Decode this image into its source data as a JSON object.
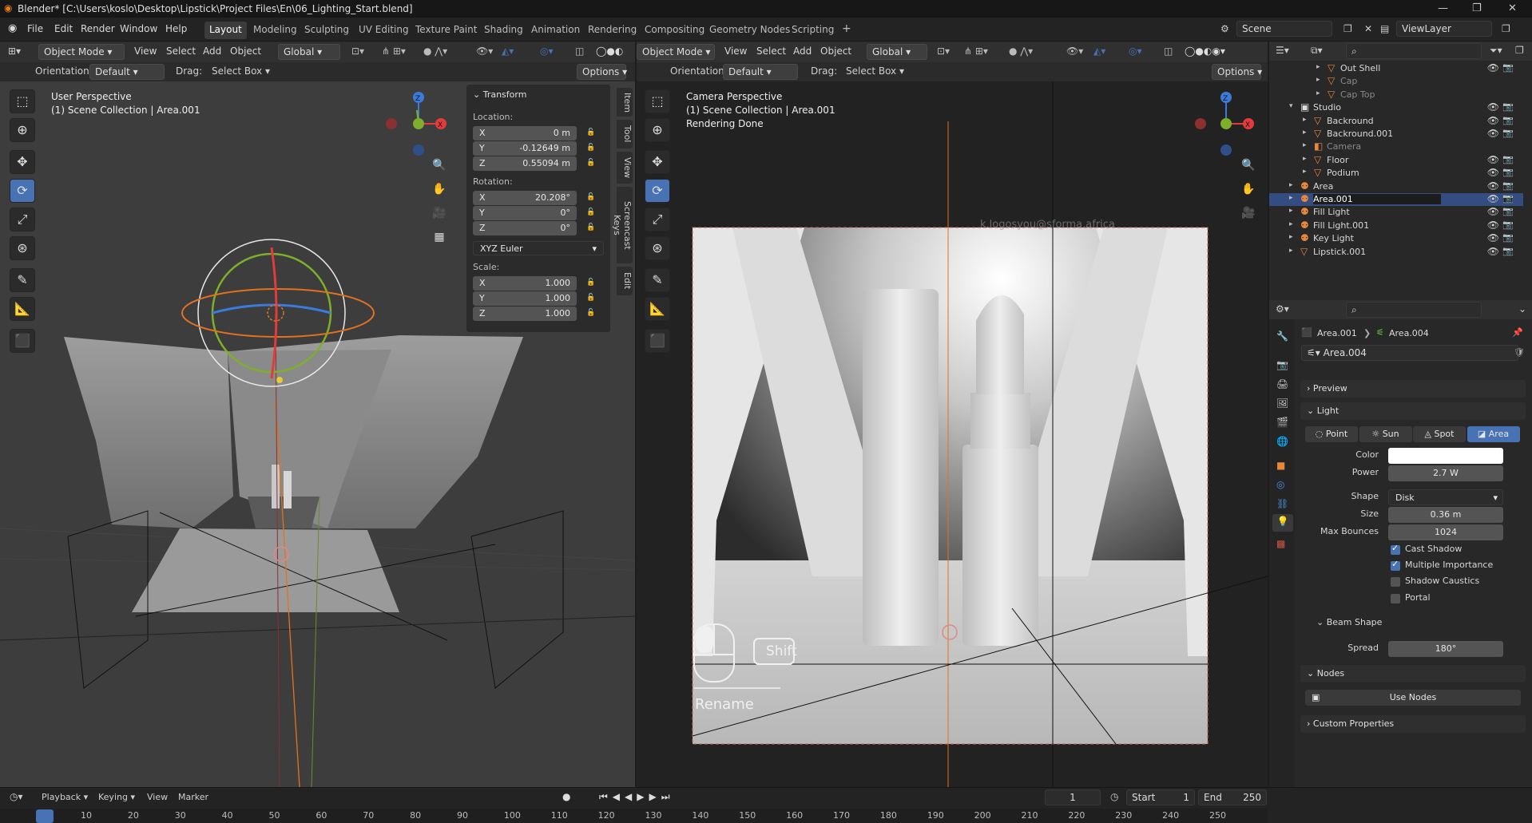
{
  "titlebar": {
    "title": "Blender* [C:\\Users\\koslo\\Desktop\\Lipstick\\Project Files\\En\\06_Lighting_Start.blend]"
  },
  "menu": [
    "File",
    "Edit",
    "Render",
    "Window",
    "Help"
  ],
  "workspaces": [
    "Layout",
    "Modeling",
    "Sculpting",
    "UV Editing",
    "Texture Paint",
    "Shading",
    "Animation",
    "Rendering",
    "Compositing",
    "Geometry Nodes",
    "Scripting"
  ],
  "scene": {
    "scene_name": "Scene",
    "view_layer": "ViewLayer"
  },
  "left_view": {
    "mode": "Object Mode",
    "menus": [
      "View",
      "Select",
      "Add",
      "Object"
    ],
    "transform_orient": "Global",
    "orientation_label": "Orientation:",
    "orientation_value": "Default",
    "drag_label": "Drag:",
    "drag_value": "Select Box",
    "options": "Options",
    "title": "User Perspective",
    "subtitle": "(1) Scene Collection | Area.001",
    "tabs": [
      "Item",
      "Tool",
      "View",
      "Screencast Keys",
      "Edit"
    ],
    "transform": {
      "header": "Transform",
      "location_label": "Location:",
      "rotation_label": "Rotation:",
      "scale_label": "Scale:",
      "location": [
        {
          "axis": "X",
          "value": "0 m"
        },
        {
          "axis": "Y",
          "value": "-0.12649 m"
        },
        {
          "axis": "Z",
          "value": "0.55094 m"
        }
      ],
      "rotation": [
        {
          "axis": "X",
          "value": "20.208°"
        },
        {
          "axis": "Y",
          "value": "0°"
        },
        {
          "axis": "Z",
          "value": "0°"
        }
      ],
      "rotation_mode": "XYZ Euler",
      "scale": [
        {
          "axis": "X",
          "value": "1.000"
        },
        {
          "axis": "Y",
          "value": "1.000"
        },
        {
          "axis": "Z",
          "value": "1.000"
        }
      ]
    }
  },
  "right_view": {
    "mode": "Object Mode",
    "menus": [
      "View",
      "Select",
      "Add",
      "Object"
    ],
    "transform_orient": "Global",
    "orientation_label": "Orientation:",
    "orientation_value": "Default",
    "drag_label": "Drag:",
    "drag_value": "Select Box",
    "options": "Options",
    "title": "Camera Perspective",
    "subtitle": "(1) Scene Collection | Area.001",
    "status": "Rendering Done",
    "overlay_key": "Shift",
    "overlay_action": "Rename",
    "watermark": "k.logosyou@sforma.africa"
  },
  "gizmo": {
    "z": "Z",
    "x": "X",
    "y": "Y"
  },
  "outliner": {
    "rows": [
      {
        "label": "Out Shell",
        "indent": 3,
        "state": "normal"
      },
      {
        "label": "Cap",
        "indent": 3,
        "state": "dim"
      },
      {
        "label": "Cap Top",
        "indent": 3,
        "state": "dim"
      },
      {
        "label": "Studio",
        "indent": 1,
        "state": "collection"
      },
      {
        "label": "Backround",
        "indent": 2,
        "state": "normal"
      },
      {
        "label": "Backround.001",
        "indent": 2,
        "state": "normal"
      },
      {
        "label": "Camera",
        "indent": 2,
        "state": "dim"
      },
      {
        "label": "Floor",
        "indent": 2,
        "state": "normal"
      },
      {
        "label": "Podium",
        "indent": 2,
        "state": "normal"
      },
      {
        "label": "Area",
        "indent": 1,
        "state": "light"
      },
      {
        "label": "Area.001",
        "indent": 1,
        "state": "selected"
      },
      {
        "label": "Fill Light",
        "indent": 1,
        "state": "light"
      },
      {
        "label": "Fill Light.001",
        "indent": 1,
        "state": "light"
      },
      {
        "label": "Key Light",
        "indent": 1,
        "state": "light"
      },
      {
        "label": "Lipstick.001",
        "indent": 1,
        "state": "normal"
      }
    ]
  },
  "properties": {
    "breadcrumb_obj": "Area.001",
    "breadcrumb_data": "Area.004",
    "datablock": "Area.004",
    "preview": "Preview",
    "light": "Light",
    "light_types": [
      {
        "label": "Point",
        "active": false
      },
      {
        "label": "Sun",
        "active": false
      },
      {
        "label": "Spot",
        "active": false
      },
      {
        "label": "Area",
        "active": true
      }
    ],
    "color_label": "Color",
    "color": "#ffffff",
    "power_label": "Power",
    "power": "2.7 W",
    "shape_label": "Shape",
    "shape": "Disk",
    "size_label": "Size",
    "size": "0.36 m",
    "bounces_label": "Max Bounces",
    "bounces": "1024",
    "cast_shadow": "Cast Shadow",
    "multiple_importance": "Multiple Importance",
    "shadow_caustics": "Shadow Caustics",
    "portal": "Portal",
    "beam_shape": "Beam Shape",
    "spread_label": "Spread",
    "spread": "180°",
    "nodes": "Nodes",
    "use_nodes": "Use Nodes",
    "custom_props": "Custom Properties"
  },
  "timeline": {
    "menus": [
      "Playback",
      "Keying",
      "View",
      "Marker"
    ],
    "current": "1",
    "start_label": "Start",
    "start": "1",
    "end_label": "End",
    "end": "250",
    "ticks": [
      "1",
      "10",
      "20",
      "30",
      "40",
      "50",
      "60",
      "70",
      "80",
      "90",
      "100",
      "110",
      "120",
      "130",
      "140",
      "150",
      "160",
      "170",
      "180",
      "190",
      "200",
      "210",
      "220",
      "230",
      "240",
      "250"
    ]
  }
}
